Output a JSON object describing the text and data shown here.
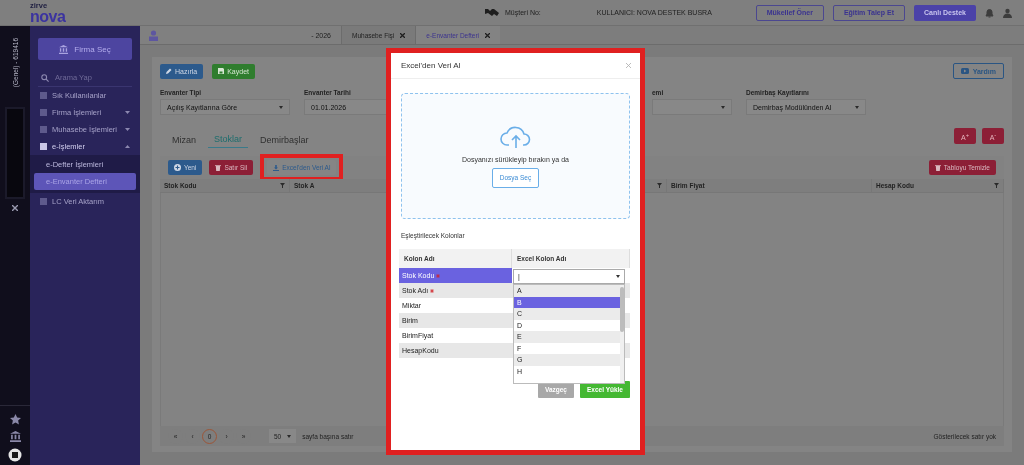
{
  "header": {
    "logo_small": "zirve",
    "logo": "nova",
    "customer_label": "Müşteri No:",
    "user": "KULLANICI: NOVA DESTEK BUSRA",
    "buttons": [
      {
        "label": "Mükellef Öner",
        "kind": "outline"
      },
      {
        "label": "Eğitim Talep Et",
        "kind": "outline"
      },
      {
        "label": "Canlı Destek",
        "kind": "solid"
      }
    ]
  },
  "rail": {
    "company": "(Genel) - 619416"
  },
  "sidebar": {
    "company_button": "Firma Seç",
    "search": {
      "placeholder": "Arama Yap"
    },
    "items": [
      {
        "label": "Sık Kullanılanlar",
        "kind": "link",
        "expanded": false
      },
      {
        "label": "Firma İşlemleri",
        "kind": "group",
        "expanded": false
      },
      {
        "label": "Muhasebe İşlemleri",
        "kind": "group",
        "expanded": false
      },
      {
        "label": "e-İşlemler",
        "kind": "group",
        "expanded": true,
        "children": [
          {
            "label": "e-Defter İşlemleri",
            "selected": false
          },
          {
            "label": "e-Envanter Defteri",
            "selected": true
          }
        ]
      },
      {
        "label": "LC Veri Aktarım",
        "kind": "link",
        "expanded": false
      }
    ]
  },
  "doc_tabs": {
    "title": "- 2026",
    "tabs": [
      {
        "label": "Muhasebe Fişi",
        "selected": false
      },
      {
        "label": "e-Envanter Defteri",
        "selected": true
      }
    ]
  },
  "toolbar": {
    "buttons": [
      {
        "label": "Hazırla",
        "kind": "edit"
      },
      {
        "label": "Kaydet",
        "kind": "save"
      }
    ],
    "help": "Yardım"
  },
  "filters": [
    {
      "label": "Envanter Tipi",
      "kind": "select",
      "value": "Açılış Kayıtlarına Göre"
    },
    {
      "label": "Envanter Tarihi",
      "kind": "date",
      "value": "01.01.2026"
    },
    {
      "label": "emi",
      "kind": "select"
    },
    {
      "label": "Demirbaş Kayıtlarını",
      "kind": "select",
      "value": "Demirbaş Modülünden Al"
    }
  ],
  "section_tabs": [
    {
      "label": "Mizan",
      "selected": false
    },
    {
      "label": "Stoklar",
      "selected": true
    },
    {
      "label": "Demirbaşlar",
      "selected": false
    }
  ],
  "font_buttons": [
    "A$^{+}$",
    "A$^{-}$"
  ],
  "grid": {
    "buttons": [
      {
        "label": "Yeni",
        "kind": "new"
      },
      {
        "label": "Satır Sil",
        "kind": "delete"
      },
      {
        "label": "Excel'den Veri Al",
        "kind": "import"
      }
    ],
    "clear": "Tabloyu Temizle",
    "columns": [
      {
        "label": "Stok Kodu",
        "filter": true
      },
      {
        "label": "Stok A"
      },
      {
        "filter": true
      },
      {
        "label": "Birim Fiyat",
        "filter": false
      },
      {
        "label": "Hesap Kodu",
        "filter": true
      }
    ]
  },
  "pager": {
    "buttons": [
      {
        "label": "«",
        "selected": false
      },
      {
        "label": "‹",
        "selected": false
      },
      {
        "label": "0",
        "selected": true
      },
      {
        "label": "›",
        "selected": false
      },
      {
        "label": "»",
        "selected": false
      }
    ],
    "page_size": "50",
    "per_page": "sayfa başına satır",
    "empty": "Gösterilecek satır yok"
  },
  "modal": {
    "title": "Excel'den Veri Al",
    "drop_text": "Dosyanızı sürükleyip bırakın ya da",
    "file_button": "Dosya Seç",
    "section": "Eşleştirilecek Kolonlar",
    "columns": [
      "Kolon Adı",
      "Excel Kolon Adı"
    ],
    "rows": [
      {
        "name": "Stok Kodu",
        "required": true,
        "selected": true
      },
      {
        "name": "Stok Adı",
        "required": true,
        "selected": false
      },
      {
        "name": "Miktar",
        "required": false,
        "selected": false
      },
      {
        "name": "Birim",
        "required": false,
        "selected": false
      },
      {
        "name": "BirimFiyat",
        "required": false,
        "selected": false
      },
      {
        "name": "HesapKodu",
        "required": false,
        "selected": false
      }
    ],
    "dropdown": {
      "value": "|",
      "options": [
        {
          "label": "A",
          "selected": false
        },
        {
          "label": "B",
          "selected": true
        },
        {
          "label": "C",
          "selected": false
        },
        {
          "label": "D",
          "selected": false
        },
        {
          "label": "E",
          "selected": false
        },
        {
          "label": "F",
          "selected": false
        },
        {
          "label": "G",
          "selected": false
        },
        {
          "label": "H",
          "selected": false
        }
      ]
    },
    "buttons": [
      {
        "label": "Vazgeç",
        "kind": "cancel"
      },
      {
        "label": "Excel Yükle",
        "kind": "submit"
      }
    ]
  }
}
